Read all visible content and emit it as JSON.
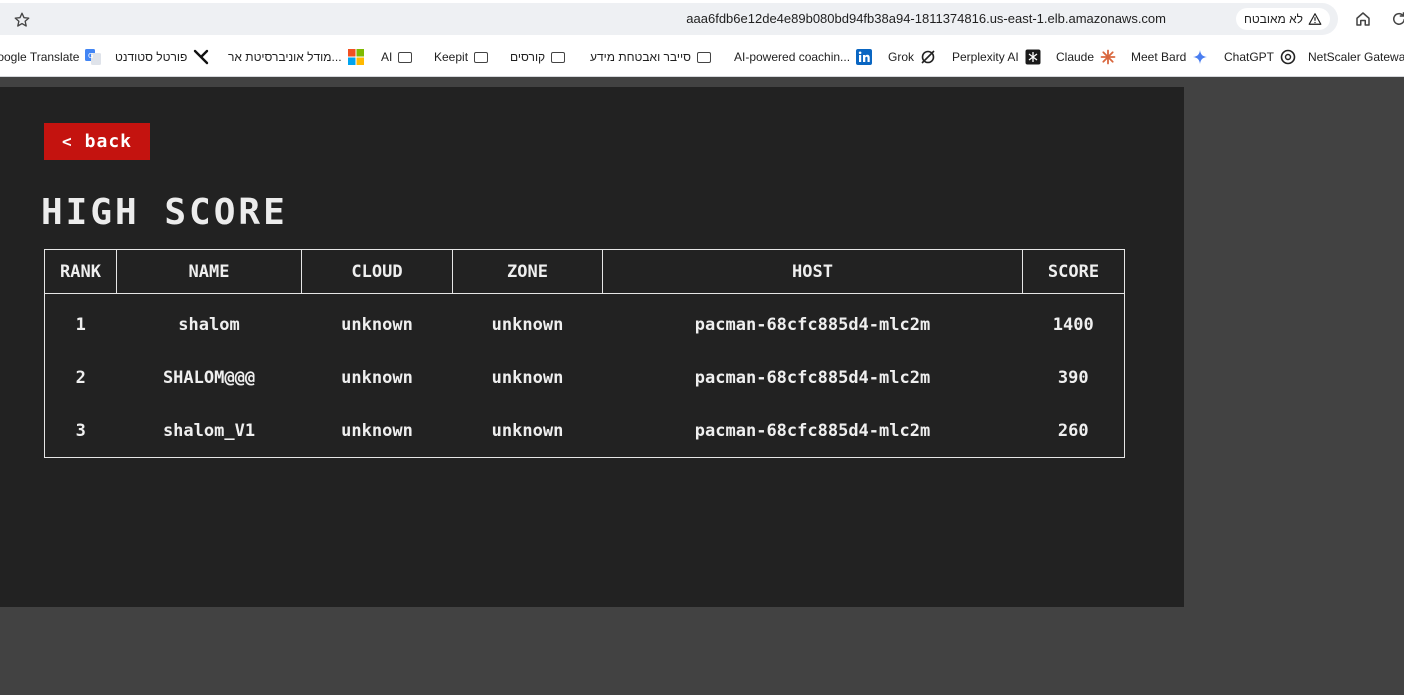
{
  "browser": {
    "url": "aaa6fdb6e12de4e89b080bd94fb38a94-1811374816.us-east-1.elb.amazonaws.com",
    "security_label": "לא מאובטח"
  },
  "bookmarks": [
    {
      "label": "NetScaler Gateway",
      "icon": "netscaler-icon"
    },
    {
      "label": "ChatGPT",
      "icon": "chatgpt-icon"
    },
    {
      "label": "Meet Bard",
      "icon": "bard-icon"
    },
    {
      "label": "Claude",
      "icon": "claude-icon"
    },
    {
      "label": "Perplexity AI",
      "icon": "perplexity-icon"
    },
    {
      "label": "Grok",
      "icon": "grok-icon"
    },
    {
      "label": "AI-powered coachin...",
      "icon": "linkedin-icon"
    },
    {
      "label": "סייבר ואבטחת מידע",
      "icon": "folder-icon"
    },
    {
      "label": "קורסים",
      "icon": "folder-icon"
    },
    {
      "label": "Keepit",
      "icon": "folder-icon"
    },
    {
      "label": "AI",
      "icon": "folder-icon"
    },
    {
      "label": "מודל אוניברסיטת אר...",
      "icon": "microsoft-icon"
    },
    {
      "label": "פורטל סטודנט",
      "icon": "portal-icon"
    },
    {
      "label": "Google Translate",
      "icon": "translate-icon"
    }
  ],
  "game": {
    "back_label": "back",
    "title": "HIGH SCORE",
    "columns": {
      "rank": "RANK",
      "name": "NAME",
      "cloud": "CLOUD",
      "zone": "ZONE",
      "host": "HOST",
      "score": "SCORE"
    },
    "rows": [
      {
        "rank": "1",
        "name": "shalom",
        "cloud": "unknown",
        "zone": "unknown",
        "host": "pacman-68cfc885d4-mlc2m",
        "score": "1400"
      },
      {
        "rank": "2",
        "name": "SHALOM@@@",
        "cloud": "unknown",
        "zone": "unknown",
        "host": "pacman-68cfc885d4-mlc2m",
        "score": "390"
      },
      {
        "rank": "3",
        "name": "shalom_V1",
        "cloud": "unknown",
        "zone": "unknown",
        "host": "pacman-68cfc885d4-mlc2m",
        "score": "260"
      }
    ]
  },
  "colors": {
    "accent_red": "#c4130f",
    "panel_bg": "#222222",
    "page_bg": "#424242"
  }
}
